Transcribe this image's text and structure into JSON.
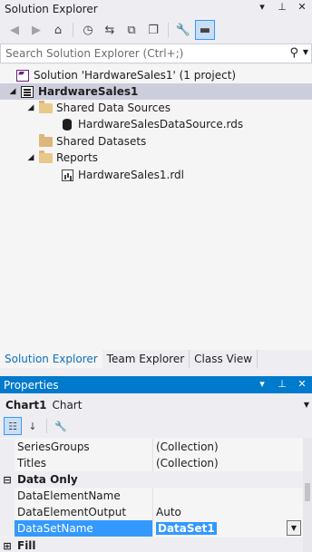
{
  "solution_explorer": {
    "title": "Solution Explorer",
    "title_buttons": [
      "▾",
      "⊥",
      "✕"
    ],
    "search_placeholder": "Search Solution Explorer (Ctrl+;)",
    "tree": {
      "solution": "Solution 'HardwareSales1' (1 project)",
      "project": "HardwareSales1",
      "shared_data_sources": "Shared Data Sources",
      "datasource_file": "HardwareSalesDataSource.rds",
      "shared_datasets": "Shared Datasets",
      "reports": "Reports",
      "report_file": "HardwareSales1.rdl"
    },
    "tabs": [
      "Solution Explorer",
      "Team Explorer",
      "Class View"
    ]
  },
  "properties": {
    "title": "Properties",
    "title_buttons": [
      "▾",
      "⊥",
      "✕"
    ],
    "object_name": "Chart1",
    "object_type": "Chart",
    "rows": [
      {
        "name": "SeriesGroups",
        "value": "(Collection)"
      },
      {
        "name": "Titles",
        "value": "(Collection)"
      }
    ],
    "category_data_only": "Data Only",
    "data_rows": [
      {
        "name": "DataElementName",
        "value": ""
      },
      {
        "name": "DataElementOutput",
        "value": "Auto"
      },
      {
        "name": "DataSetName",
        "value": "DataSet1"
      }
    ],
    "category_fill": "Fill",
    "toggle_expanded": "⊟",
    "toggle_collapsed": "⊞"
  },
  "colors": {
    "accent": "#007acc",
    "selection": "#3399ff"
  }
}
